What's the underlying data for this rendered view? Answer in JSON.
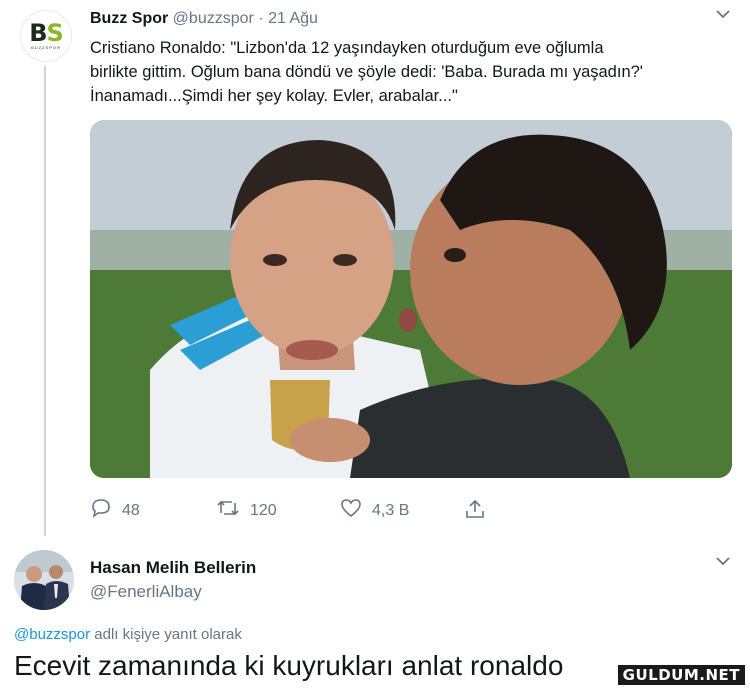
{
  "tweet": {
    "author_name": "Buzz Spor",
    "author_handle": "@buzzspor",
    "separator": "·",
    "date": "21 Ağu",
    "avatar": {
      "mark_left": "B",
      "mark_right": "S",
      "subtext": "BUZZSPOR"
    },
    "text": "Cristiano Ronaldo: \"Lizbon'da 12 yaşındayken oturduğum eve oğlumla\nbirlikte gittim. Oğlum bana döndü ve şöyle dedi: 'Baba. Burada mı yaşadın?'\nİnanamadı...Şimdi her şey kolay. Evler, arabalar...\"",
    "icons": {
      "reply": "reply-icon",
      "retweet": "retweet-icon",
      "like": "heart-icon",
      "share": "share-icon",
      "menu": "chevron-down-icon"
    },
    "counts": {
      "replies": "48",
      "retweets": "120",
      "likes": "4,3 B"
    }
  },
  "reply": {
    "author_name": "Hasan Melih Bellerin",
    "author_handle": "@FenerliAlbay",
    "reply_to_mention": "@buzzspor",
    "reply_to_suffix": " adlı kişiye yanıt olarak",
    "text": "Ecevit zamanında ki kuyrukları anlat ronaldo"
  },
  "watermark": "GULDUM.NET",
  "colors": {
    "accent": "#1b95e0",
    "muted": "#657786",
    "text": "#14171a",
    "thread_line": "#ccd6dd"
  }
}
